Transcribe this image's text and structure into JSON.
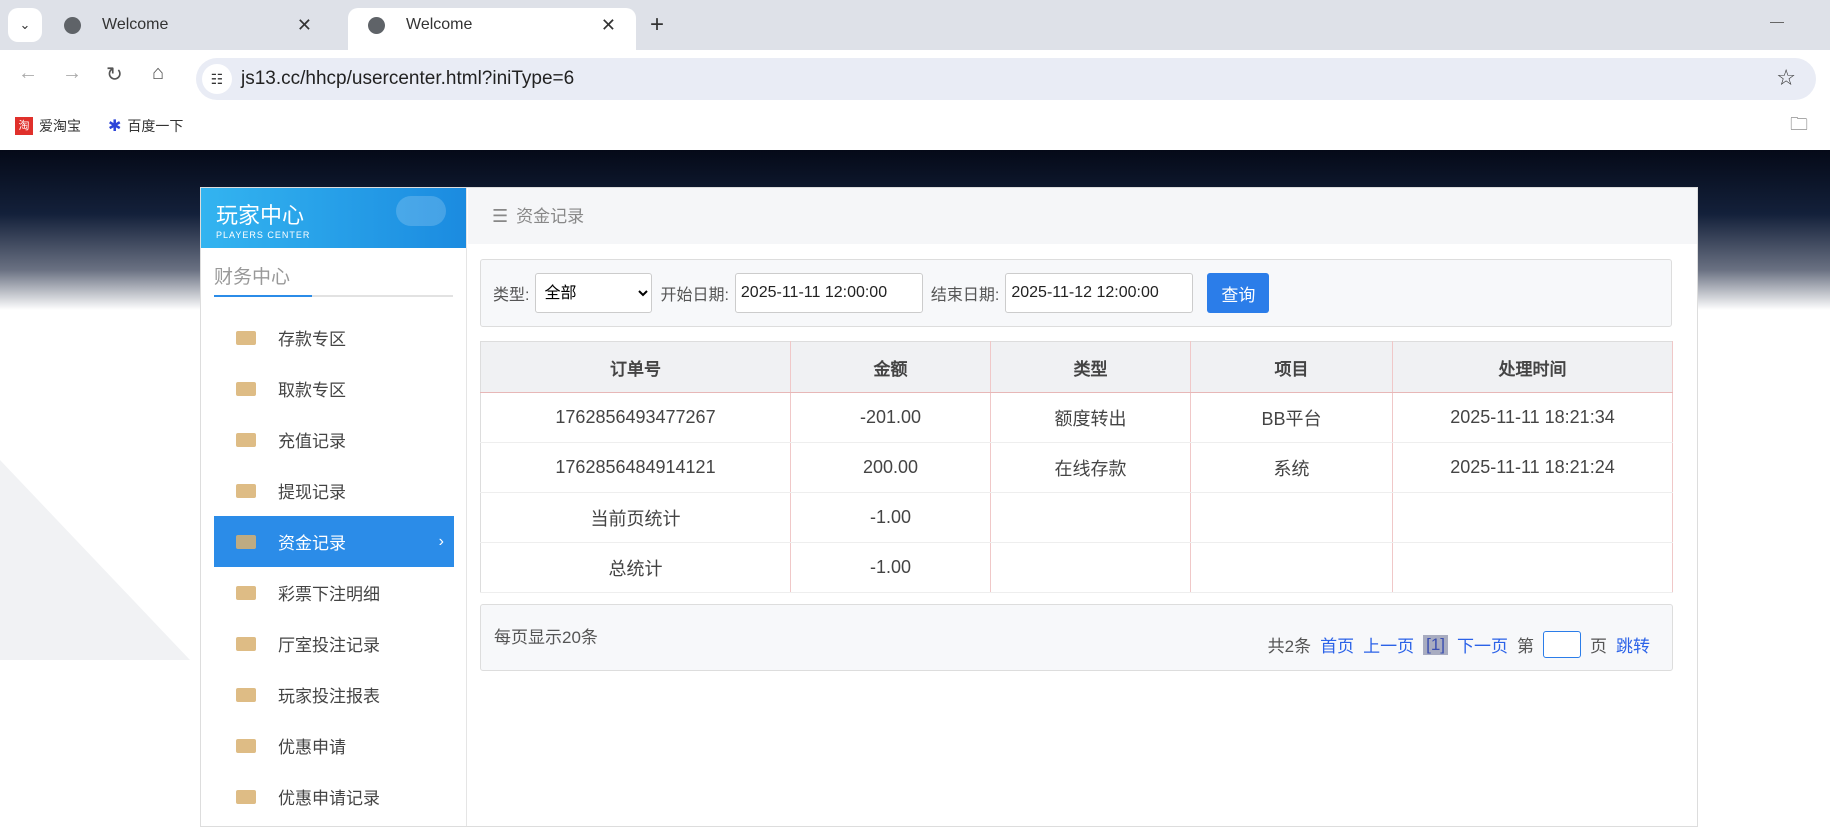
{
  "browser": {
    "tabs": [
      {
        "title": "Welcome"
      },
      {
        "title": "Welcome"
      }
    ],
    "url": "js13.cc/hhcp/usercenter.html?iniType=6",
    "bookmarks": [
      {
        "label": "爱淘宝",
        "icon": "taobao-icon"
      },
      {
        "label": "百度一下",
        "icon": "baidu-paw-icon"
      }
    ],
    "taobao_glyph": "淘"
  },
  "sidebar": {
    "brand_cn": "玩家中心",
    "brand_en": "PLAYERS CENTER",
    "section": "财务中心",
    "items": [
      {
        "label": "存款专区",
        "icon": "card-icon"
      },
      {
        "label": "取款专区",
        "icon": "hand-money-icon"
      },
      {
        "label": "充值记录",
        "icon": "money-bag-icon"
      },
      {
        "label": "提现记录",
        "icon": "wallet-icon"
      },
      {
        "label": "资金记录",
        "icon": "wallet-icon",
        "active": true
      },
      {
        "label": "彩票下注明细",
        "icon": "ticket-icon"
      },
      {
        "label": "厅室投注记录",
        "icon": "list-icon"
      },
      {
        "label": "玩家投注报表",
        "icon": "chart-icon"
      },
      {
        "label": "优惠申请",
        "icon": "gift-icon"
      },
      {
        "label": "优惠申请记录",
        "icon": "list-icon"
      }
    ]
  },
  "main": {
    "title": "资金记录",
    "filter": {
      "type_label": "类型:",
      "type_value": "全部",
      "start_label": "开始日期:",
      "start_value": "2025-11-11 12:00:00",
      "end_label": "结束日期:",
      "end_value": "2025-11-12 12:00:00",
      "query": "查询"
    },
    "table": {
      "headers": [
        "订单号",
        "金额",
        "类型",
        "项目",
        "处理时间"
      ],
      "rows": [
        [
          "1762856493477267",
          "-201.00",
          "额度转出",
          "BB平台",
          "2025-11-11 18:21:34"
        ],
        [
          "1762856484914121",
          "200.00",
          "在线存款",
          "系统",
          "2025-11-11 18:21:24"
        ],
        [
          "当前页统计",
          "-1.00",
          "",
          "",
          ""
        ],
        [
          "总统计",
          "-1.00",
          "",
          "",
          ""
        ]
      ]
    },
    "pager": {
      "per_page": "每页显示20条",
      "total": "共2条",
      "first": "首页",
      "prev": "上一页",
      "current": "[1]",
      "next": "下一页",
      "page_prefix": "第",
      "page_suffix": "页",
      "jump": "跳转"
    }
  },
  "colors": {
    "accent": "#2b8ce8",
    "button": "#2b7de9",
    "link": "#2b62e8"
  }
}
